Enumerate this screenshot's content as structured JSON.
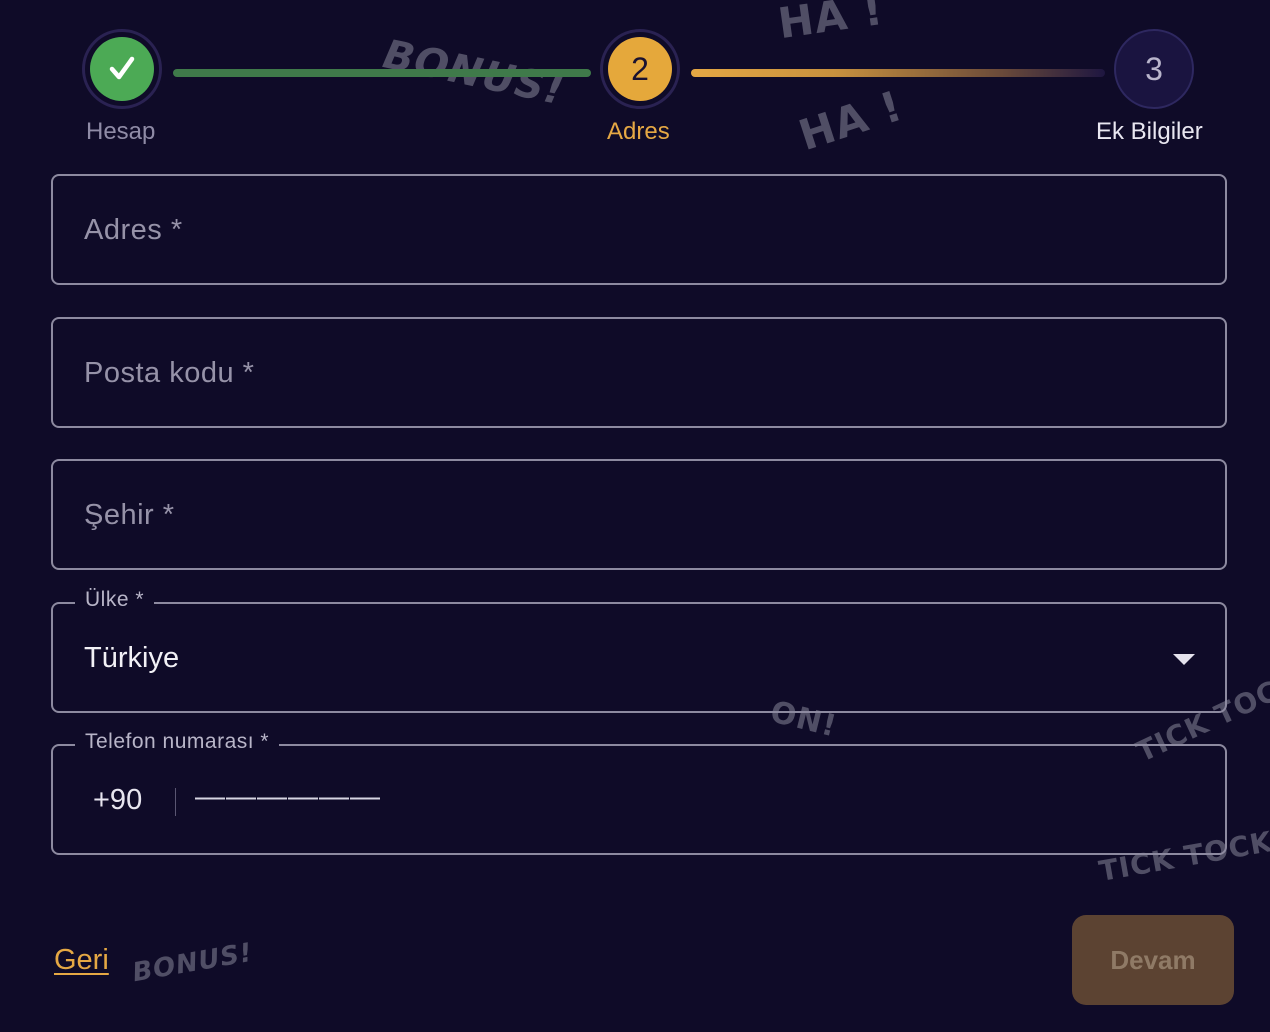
{
  "stepper": {
    "steps": [
      {
        "label": "Hesap",
        "marker": "✓",
        "state": "completed"
      },
      {
        "label": "Adres",
        "marker": "2",
        "state": "active"
      },
      {
        "label": "Ek Bilgiler",
        "marker": "3",
        "state": "pending"
      }
    ]
  },
  "form": {
    "address": {
      "placeholder": "Adres *"
    },
    "postal_code": {
      "placeholder": "Posta kodu *"
    },
    "city": {
      "placeholder": "Şehir *"
    },
    "country": {
      "label": "Ülke *",
      "value": "Türkiye"
    },
    "phone": {
      "label": "Telefon numarası *",
      "prefix": "+90",
      "mask": "——————"
    }
  },
  "actions": {
    "back_label": "Geri",
    "next_label": "Devam"
  },
  "decorations": {
    "doodle_1": "BONUS!",
    "doodle_2": "HA !",
    "doodle_3": "HA !",
    "doodle_4": "BONUS!",
    "doodle_5": "TICK TOCK",
    "doodle_6": "TICK TOCK",
    "doodle_7": "ON!"
  },
  "colors": {
    "background": "#0f0b28",
    "accent": "#e5a844",
    "success": "#4caa55",
    "field_border": "#8d8aa0",
    "button_disabled": "#5c4332"
  }
}
